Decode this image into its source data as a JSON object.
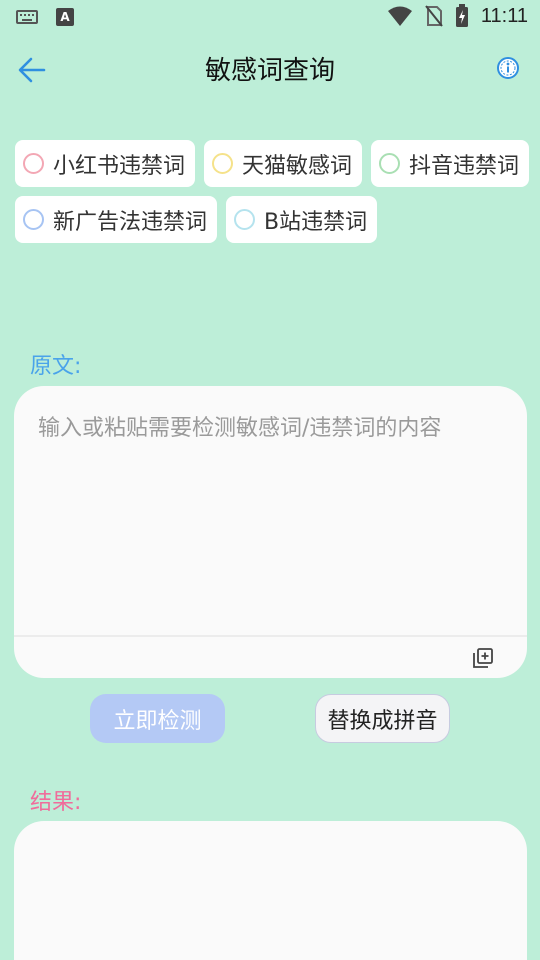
{
  "status_bar": {
    "time": "11:11",
    "a_icon_letter": "A",
    "icons": [
      "keyboard-icon",
      "a-notification-icon",
      "wifi-icon",
      "no-sim-icon",
      "battery-icon"
    ]
  },
  "header": {
    "title": "敏感词查询",
    "back_icon": "arrow-left-icon",
    "info_icon": "info-icon"
  },
  "categories": [
    {
      "label": "小红书违禁词",
      "color": "#f3a7b4"
    },
    {
      "label": "天猫敏感词",
      "color": "#f5e28a"
    },
    {
      "label": "抖音违禁词",
      "color": "#a9dfb3"
    },
    {
      "label": "新广告法违禁词",
      "color": "#a7c4f3"
    },
    {
      "label": "B站违禁词",
      "color": "#b5e3ee"
    }
  ],
  "source": {
    "label": "原文:",
    "placeholder": "输入或粘贴需要检测敏感词/违禁词的内容",
    "value": ""
  },
  "actions": {
    "detect_label": "立即检测",
    "pinyin_label": "替换成拼音"
  },
  "result": {
    "label": "结果:"
  },
  "colors": {
    "background": "#bdeed8",
    "accent_blue": "#4aa3ea",
    "accent_pink": "#f06c9b",
    "detect_button": "#b4c9f5"
  }
}
